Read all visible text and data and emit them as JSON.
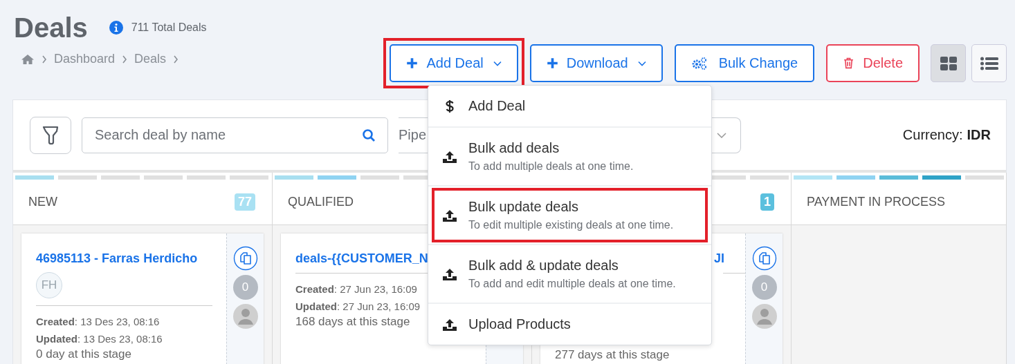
{
  "page": {
    "title": "Deals",
    "total": "711 Total Deals"
  },
  "breadcrumb": [
    "Dashboard",
    "Deals"
  ],
  "actions": [
    {
      "label": "Add Deal",
      "kind": "add",
      "caret": true,
      "highlighted": true
    },
    {
      "label": "Download",
      "kind": "add",
      "caret": true,
      "highlighted": false
    },
    {
      "label": "Bulk Change",
      "kind": "gears",
      "caret": false,
      "highlighted": false
    },
    {
      "label": "Delete",
      "kind": "delete",
      "caret": false,
      "highlighted": false
    }
  ],
  "views": [
    {
      "kind": "grid",
      "selected": true
    },
    {
      "kind": "list",
      "selected": false
    }
  ],
  "toolbar": {
    "search_placeholder": "Search deal by name",
    "pipeline_label": "Pipe",
    "currency_label": "Currency:",
    "currency": "IDR"
  },
  "columns": [
    {
      "kind": "open",
      "title": "NEW",
      "count": "77",
      "color": "#a9e1f3",
      "segments": [
        {
          "color": "#a8dff0"
        },
        {
          "color": "#e0e0e0"
        },
        {
          "color": "#e0e0e0"
        },
        {
          "color": "#e0e0e0"
        },
        {
          "color": "#e0e0e0"
        },
        {
          "color": "#e0e0e0"
        }
      ],
      "cards": [
        {
          "kind": "full",
          "title": "46985113 - Farras Herdicho",
          "initials": "FH",
          "created": "**Created**: 13 Des 23, 08:16",
          "updated": "**Updated**: 13 Des 23, 08:16",
          "days": "0 day at this stage",
          "notes": "0"
        }
      ]
    },
    {
      "kind": "open",
      "title": "QUALIFIED",
      "segments": [
        {
          "color": "#a8dff0"
        },
        {
          "color": "#8fd3f2"
        },
        {
          "color": "#e0e0e0"
        },
        {
          "color": "#e0e0e0"
        }
      ],
      "cards": [
        {
          "kind": "full",
          "title": "deals-{{CUSTOMER_N",
          "created": "**Created**: 27 Jun 23, 16:09",
          "updated": "**Updated**: 27 Jun 23, 16:09",
          "days": "168 days at this stage"
        }
      ]
    },
    {
      "kind": "covered",
      "count": "1",
      "color": "#5bc0de",
      "segments": [
        {
          "color": "#e0e0e0"
        },
        {
          "color": "#e0e0e0"
        }
      ],
      "cards": [
        {
          "kind": "covered",
          "title": "JI",
          "days": "277 days at this stage",
          "notes": "0"
        }
      ]
    },
    {
      "kind": "open",
      "title": "PAYMENT IN PROCESS",
      "segments": [
        {
          "color": "#b3e5f5"
        },
        {
          "color": "#8fd3f2"
        },
        {
          "color": "#5bbcd9"
        },
        {
          "color": "#2fa3c7"
        },
        {
          "color": "#e0e0e0"
        }
      ]
    }
  ],
  "menu": [
    {
      "kind": "dollar",
      "label": "Add Deal",
      "highlighted": false
    },
    {
      "kind": "upload",
      "label": "Bulk add deals",
      "description": "To add multiple deals at one time.",
      "highlighted": false
    },
    {
      "kind": "upload",
      "label": "Bulk update deals",
      "description": "To edit multiple existing deals at one time.",
      "highlighted": true
    },
    {
      "kind": "upload",
      "label": "Bulk add & update deals",
      "description": "To add and edit multiple deals at one time.",
      "highlighted": false
    },
    {
      "kind": "upload",
      "label": "Upload Products",
      "highlighted": false
    }
  ]
}
